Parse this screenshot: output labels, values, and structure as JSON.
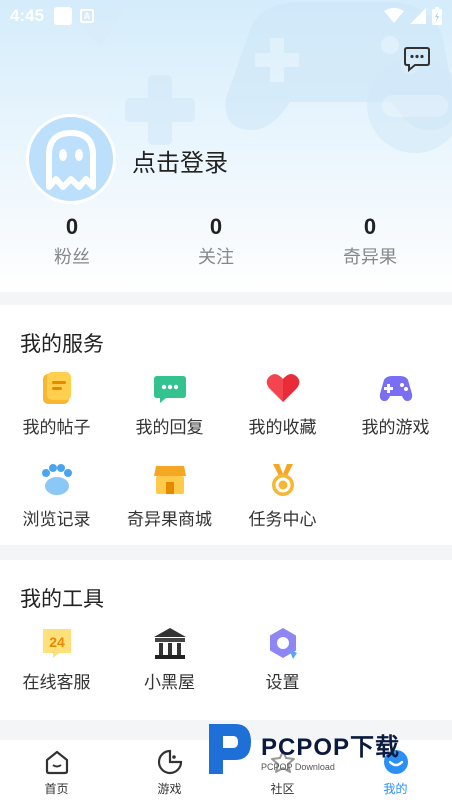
{
  "status_bar": {
    "time": "4:45",
    "notif_letter": "A"
  },
  "profile": {
    "login_text": "点击登录"
  },
  "stats": [
    {
      "value": "0",
      "label": "粉丝"
    },
    {
      "value": "0",
      "label": "关注"
    },
    {
      "value": "0",
      "label": "奇异果"
    }
  ],
  "services": {
    "title": "我的服务",
    "items": [
      {
        "label": "我的帖子",
        "icon": "post-icon"
      },
      {
        "label": "我的回复",
        "icon": "reply-icon"
      },
      {
        "label": "我的收藏",
        "icon": "heart-icon"
      },
      {
        "label": "我的游戏",
        "icon": "gamepad-icon"
      },
      {
        "label": "浏览记录",
        "icon": "paw-icon"
      },
      {
        "label": "奇异果商城",
        "icon": "shop-icon"
      },
      {
        "label": "任务中心",
        "icon": "medal-icon"
      }
    ]
  },
  "tools": {
    "title": "我的工具",
    "items": [
      {
        "label": "在线客服",
        "icon": "support-24-icon",
        "badge": "24"
      },
      {
        "label": "小黑屋",
        "icon": "jail-icon"
      },
      {
        "label": "设置",
        "icon": "settings-icon"
      }
    ]
  },
  "tabbar": {
    "items": [
      {
        "label": "首页",
        "icon": "home-icon"
      },
      {
        "label": "游戏",
        "icon": "game-icon"
      },
      {
        "label": "社区",
        "icon": "community-icon"
      },
      {
        "label": "我的",
        "icon": "profile-icon"
      }
    ],
    "active_index": 3
  },
  "watermark": {
    "main": "PCPOP下载",
    "sub": "PCPOP Download"
  },
  "colors": {
    "accent": "#2a8ff7",
    "header_bg": "#d4ecfb",
    "avatar_bg": "#bcdffb"
  }
}
